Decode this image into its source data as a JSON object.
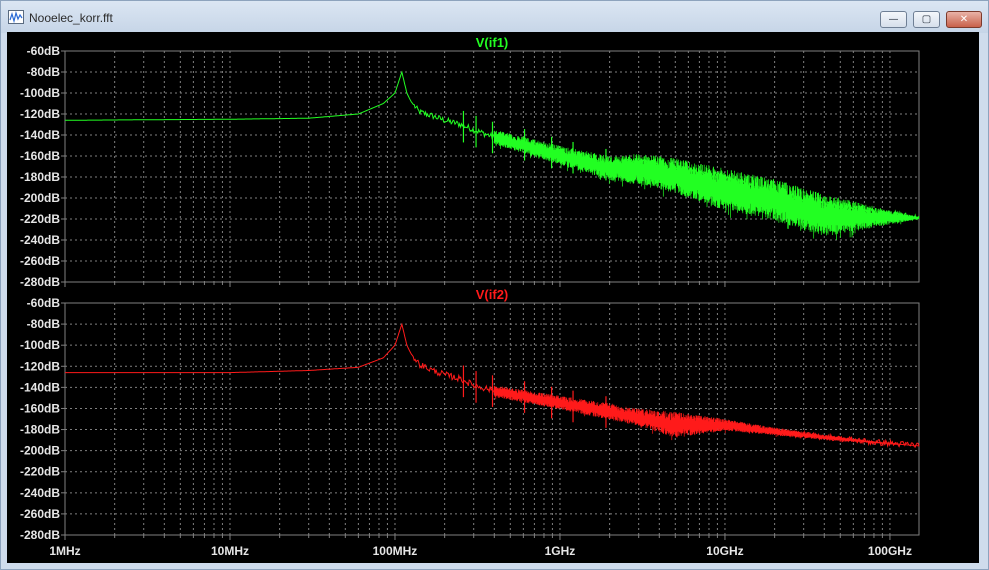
{
  "window": {
    "title": "Nooelec_korr.fft",
    "minimize_label": "—",
    "maximize_label": "▢",
    "close_label": "✕"
  },
  "colors": {
    "background": "#000000",
    "grid": "#808080",
    "axis_text": "#e6e6e6",
    "trace1": "#22ff22",
    "trace2": "#ff1a1a"
  },
  "chart_data": [
    {
      "type": "line",
      "title": "V(if1)",
      "x_scale": "log",
      "xlim": [
        1000000,
        150000000000
      ],
      "ylim": [
        -280,
        -60
      ],
      "grid": true,
      "x_tick_values": [
        1000000,
        10000000,
        100000000,
        1000000000,
        10000000000,
        100000000000
      ],
      "x_tick_labels": [
        "1MHz",
        "10MHz",
        "100MHz",
        "1GHz",
        "10GHz",
        "100GHz"
      ],
      "y_tick_values": [
        -60,
        -80,
        -100,
        -120,
        -140,
        -160,
        -180,
        -200,
        -220,
        -240,
        -260,
        -280
      ],
      "y_tick_labels": [
        "-60dB",
        "-80dB",
        "-100dB",
        "-120dB",
        "-140dB",
        "-160dB",
        "-180dB",
        "-200dB",
        "-220dB",
        "-240dB",
        "-260dB",
        "-280dB"
      ],
      "series": [
        {
          "name": "V(if1)",
          "color": "#22ff22",
          "x": [
            1000000,
            3000000,
            10000000,
            30000000,
            60000000,
            85000000,
            100000000,
            110000000,
            118000000,
            125000000,
            140000000,
            170000000,
            200000000,
            250000000,
            300000000,
            400000000,
            600000000,
            1000000000,
            2000000000,
            3000000000,
            5000000000,
            10000000000,
            20000000000,
            40000000000,
            80000000000,
            150000000000
          ],
          "y": [
            -126,
            -125.5,
            -125,
            -124,
            -120,
            -110,
            -100,
            -80,
            -100,
            -108,
            -118,
            -122,
            -126,
            -130,
            -135,
            -142,
            -148,
            -158,
            -168,
            -165,
            -172,
            -180,
            -195,
            -205,
            -212,
            -219
          ],
          "noise_band": {
            "x": [
              400000000,
              1000000000,
              2000000000,
              3000000000,
              5000000000,
              10000000000,
              20000000000,
              40000000000,
              80000000000,
              150000000000
            ],
            "lower": [
              -150,
              -170,
              -185,
              -190,
              -198,
              -215,
              -225,
              -240,
              -230,
              -220
            ],
            "upper": [
              -135,
              -150,
              -160,
              -158,
              -162,
              -172,
              -182,
              -196,
              -208,
              -218
            ]
          }
        }
      ]
    },
    {
      "type": "line",
      "title": "V(if2)",
      "x_scale": "log",
      "xlim": [
        1000000,
        150000000000
      ],
      "ylim": [
        -280,
        -60
      ],
      "grid": true,
      "x_tick_values": [
        1000000,
        10000000,
        100000000,
        1000000000,
        10000000000,
        100000000000
      ],
      "x_tick_labels": [
        "1MHz",
        "10MHz",
        "100MHz",
        "1GHz",
        "10GHz",
        "100GHz"
      ],
      "y_tick_values": [
        -60,
        -80,
        -100,
        -120,
        -140,
        -160,
        -180,
        -200,
        -220,
        -240,
        -260,
        -280
      ],
      "y_tick_labels": [
        "-60dB",
        "-80dB",
        "-100dB",
        "-120dB",
        "-140dB",
        "-160dB",
        "-180dB",
        "-200dB",
        "-220dB",
        "-240dB",
        "-260dB",
        "-280dB"
      ],
      "series": [
        {
          "name": "V(if2)",
          "color": "#ff1a1a",
          "x": [
            1000000,
            3000000,
            10000000,
            30000000,
            60000000,
            85000000,
            100000000,
            110000000,
            118000000,
            125000000,
            140000000,
            170000000,
            200000000,
            250000000,
            300000000,
            400000000,
            600000000,
            1000000000,
            2000000000,
            3000000000,
            5000000000,
            10000000000,
            20000000000,
            40000000000,
            80000000000,
            150000000000
          ],
          "y": [
            -126,
            -126,
            -126,
            -124,
            -121,
            -112,
            -100,
            -80,
            -100,
            -108,
            -118,
            -124,
            -128,
            -132,
            -138,
            -143,
            -148,
            -155,
            -163,
            -167,
            -172,
            -176,
            -182,
            -187,
            -192,
            -195
          ],
          "noise_band": {
            "x": [
              400000000,
              1000000000,
              2000000000,
              3000000000,
              5000000000,
              10000000000,
              20000000000,
              40000000000,
              80000000000,
              150000000000
            ],
            "lower": [
              -150,
              -162,
              -172,
              -178,
              -190,
              -182,
              -186,
              -190,
              -193,
              -196
            ],
            "upper": [
              -138,
              -148,
              -155,
              -160,
              -163,
              -170,
              -178,
              -185,
              -191,
              -195
            ]
          }
        }
      ]
    }
  ]
}
